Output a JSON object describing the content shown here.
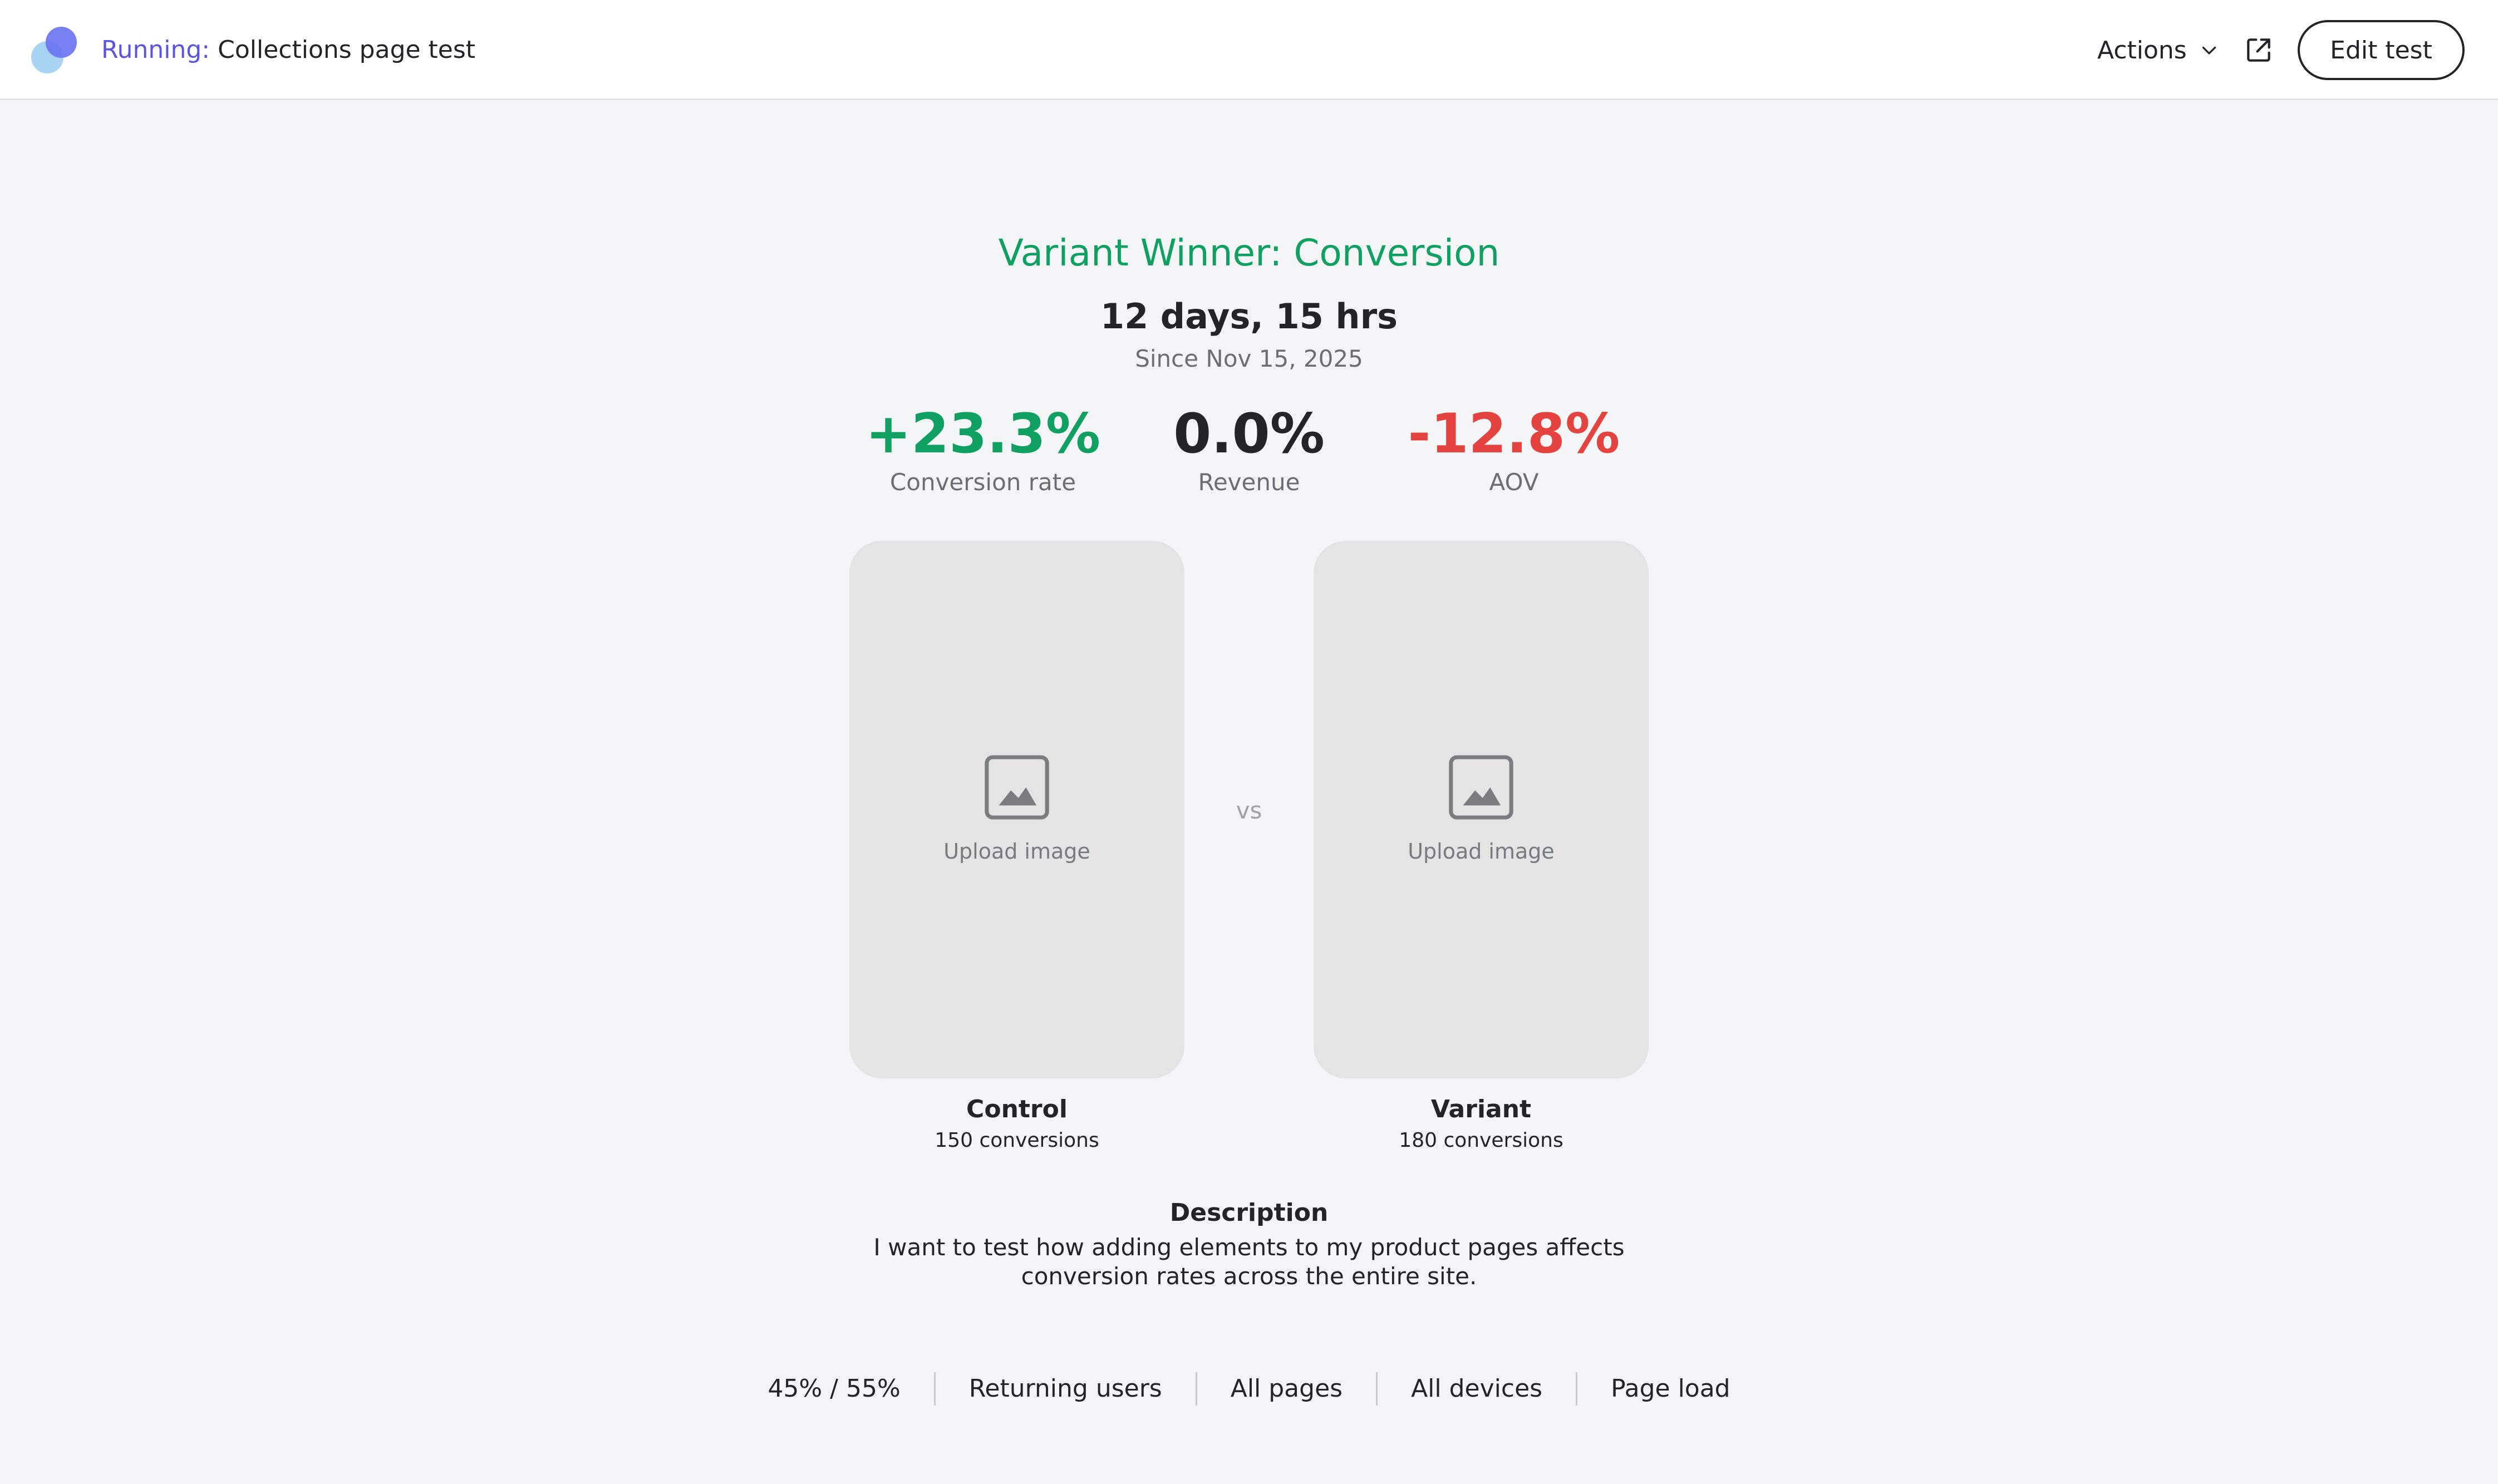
{
  "header": {
    "status": "Running:",
    "test_name": "Collections page test",
    "actions_label": "Actions",
    "edit_label": "Edit test",
    "icons": {
      "logo": "app-logo",
      "actions": "chevron-down-icon",
      "external": "external-link-icon"
    }
  },
  "summary": {
    "winner": "Variant Winner: Conversion",
    "duration": "12 days, 15 hrs",
    "since": "Since Nov 15, 2025"
  },
  "metrics": [
    {
      "value": "+23.3%",
      "label": "Conversion rate",
      "color": "#10a062"
    },
    {
      "value": "0.0%",
      "label": "Revenue",
      "color": "#222426"
    },
    {
      "value": "-12.8%",
      "label": "AOV",
      "color": "#e5433f"
    }
  ],
  "comparison": {
    "vs_label": "vs",
    "control": {
      "upload_label": "Upload image",
      "title": "Control",
      "conversions": "150 conversions"
    },
    "variant": {
      "upload_label": "Upload image",
      "title": "Variant",
      "conversions": "180 conversions"
    }
  },
  "description": {
    "title": "Description",
    "text": "I want to test how adding elements to my product pages affects conversion rates across the entire site."
  },
  "settings": [
    "45% / 55%",
    "Returning users",
    "All pages",
    "All devices",
    "Page load"
  ],
  "colors": {
    "accent": "#5b54e0",
    "positive": "#10a062",
    "negative": "#e5433f",
    "background": "#f4f5f7"
  }
}
